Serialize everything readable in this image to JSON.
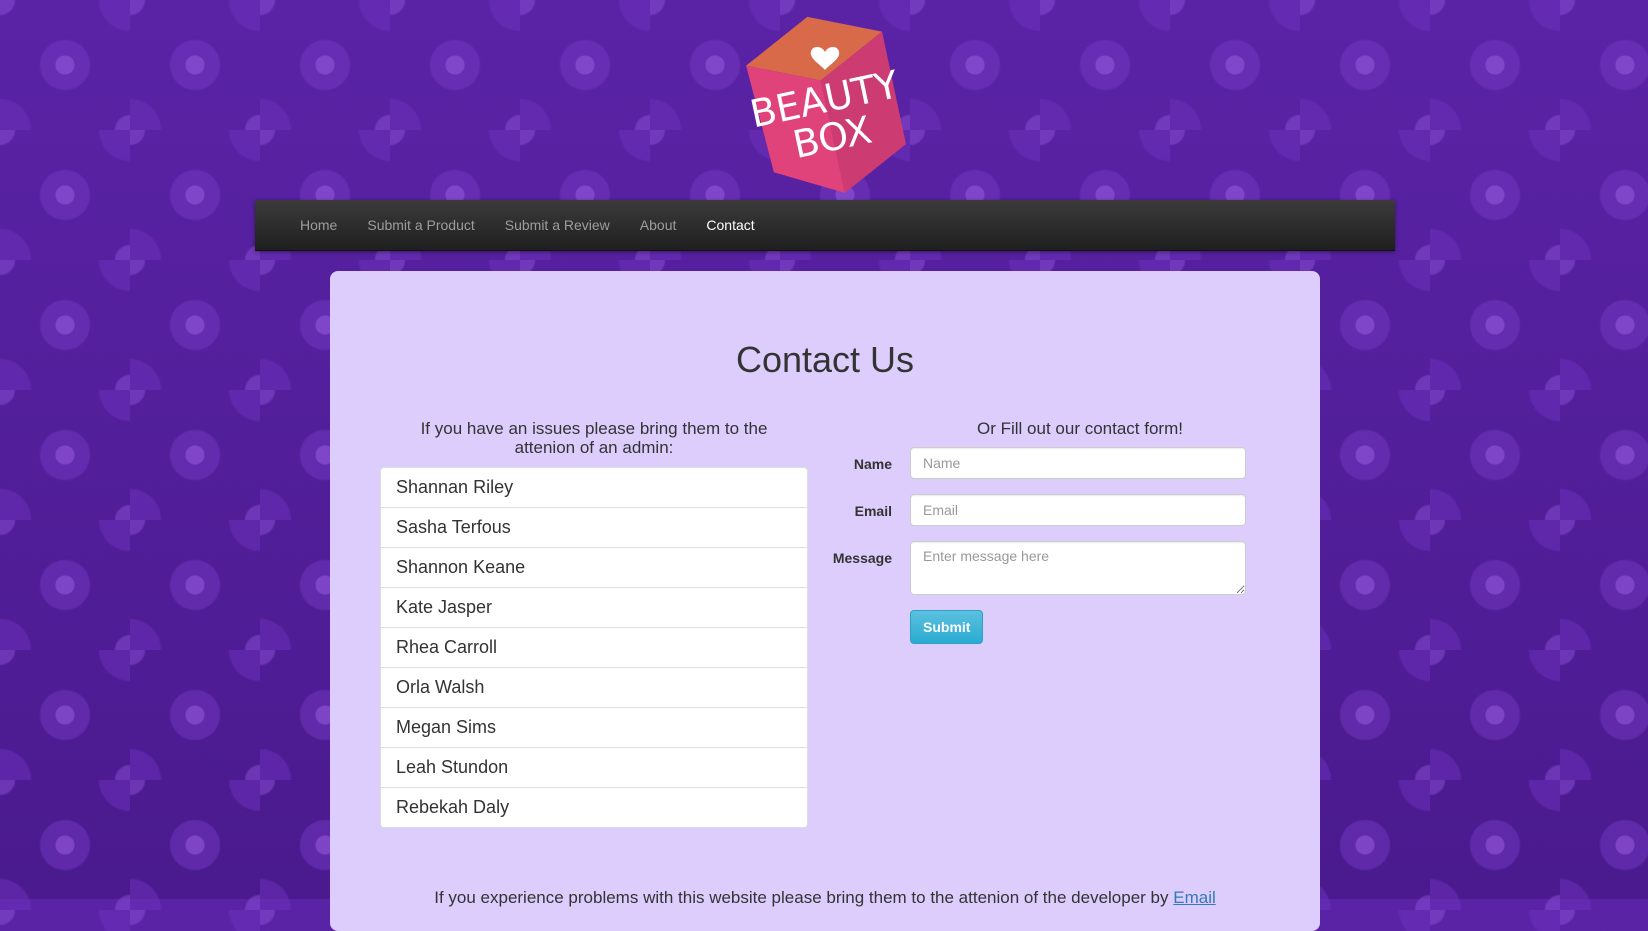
{
  "brand": {
    "logo_line1": "BEAUTY",
    "logo_line2": "BOX",
    "colors": {
      "box_top": "#d86a4a",
      "box_front": "#e0437a",
      "box_side": "#c23a6e"
    }
  },
  "nav": {
    "items": [
      {
        "label": "Home",
        "active": false
      },
      {
        "label": "Submit a Product",
        "active": false
      },
      {
        "label": "Submit a Review",
        "active": false
      },
      {
        "label": "About",
        "active": false
      },
      {
        "label": "Contact",
        "active": true
      }
    ]
  },
  "page": {
    "title": "Contact Us",
    "admins_intro": "If you have an issues please bring them to the attenion of an admin:",
    "admins": [
      "Shannan Riley",
      "Sasha Terfous",
      "Shannon Keane",
      "Kate Jasper",
      "Rhea Carroll",
      "Orla Walsh",
      "Megan Sims",
      "Leah Stundon",
      "Rebekah Daly"
    ]
  },
  "form": {
    "intro": "Or Fill out our contact form!",
    "name_label": "Name",
    "name_placeholder": "Name",
    "name_value": "",
    "email_label": "Email",
    "email_placeholder": "Email",
    "email_value": "",
    "message_label": "Message",
    "message_placeholder": "Enter message here",
    "message_value": "",
    "submit_label": "Submit"
  },
  "footer": {
    "text": "If you experience problems with this website please bring them to the attenion of the developer by ",
    "link_label": "Email"
  },
  "theme": {
    "background": "#4a1d8c",
    "panel": "#dccdfd",
    "navbar": "#222222",
    "accent_button": "#5bc0de"
  }
}
